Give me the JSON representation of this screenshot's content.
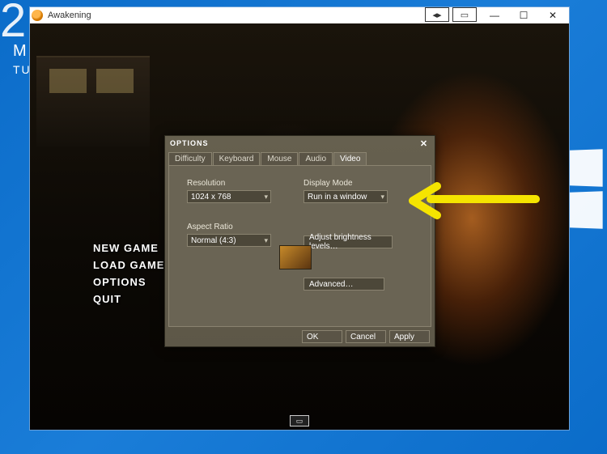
{
  "desktop": {
    "clock_fragment": "2",
    "clock_m": "M",
    "clock_d": "TU"
  },
  "window": {
    "title": "Awakening"
  },
  "main_menu": {
    "items": [
      "NEW GAME",
      "LOAD GAME",
      "OPTIONS",
      "QUIT"
    ]
  },
  "options_dialog": {
    "title": "OPTIONS",
    "tabs": [
      "Difficulty",
      "Keyboard",
      "Mouse",
      "Audio",
      "Video"
    ],
    "active_tab": "Video",
    "resolution_label": "Resolution",
    "resolution_value": "1024 x 768",
    "display_mode_label": "Display Mode",
    "display_mode_value": "Run in a window",
    "aspect_ratio_label": "Aspect Ratio",
    "aspect_ratio_value": "Normal (4:3)",
    "brightness_button": "Adjust brightness levels…",
    "advanced_button": "Advanced…",
    "ok": "OK",
    "cancel": "Cancel",
    "apply": "Apply"
  }
}
